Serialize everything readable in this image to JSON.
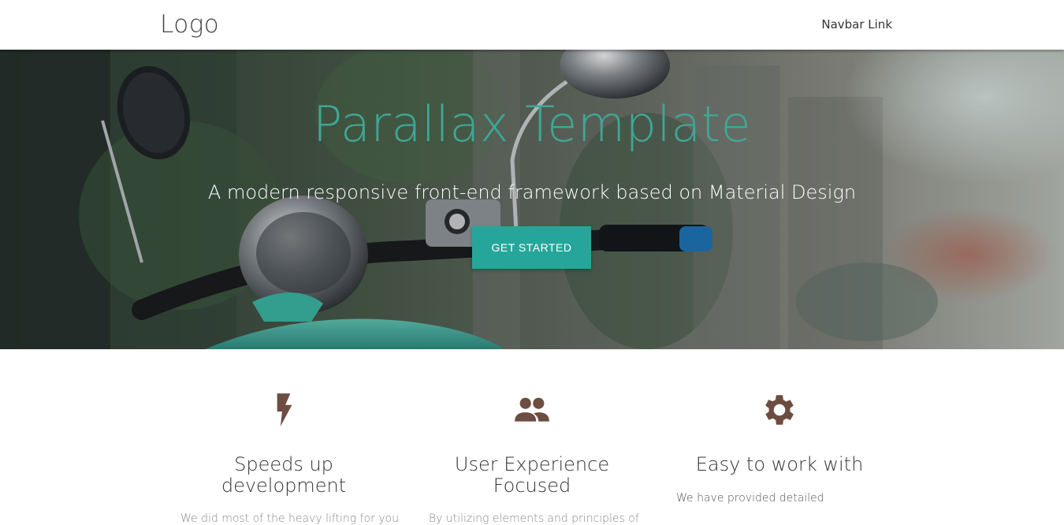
{
  "navbar": {
    "logo": "Logo",
    "link": "Navbar Link"
  },
  "hero": {
    "title": "Parallax Template",
    "subtitle": "A modern responsive front-end framework based on Material Design",
    "cta_label": "GET STARTED"
  },
  "features": [
    {
      "icon": "flash-icon",
      "title": "Speeds up development",
      "description": "We did most of the heavy lifting for you"
    },
    {
      "icon": "group-icon",
      "title": "User Experience Focused",
      "description": "By utilizing elements and principles of"
    },
    {
      "icon": "settings-icon",
      "title": "Easy to work with",
      "description": "We have provided detailed"
    }
  ],
  "colors": {
    "accent": "#26a69a",
    "title_teal": "#3fa796",
    "icon_brown": "#6d4c41"
  }
}
